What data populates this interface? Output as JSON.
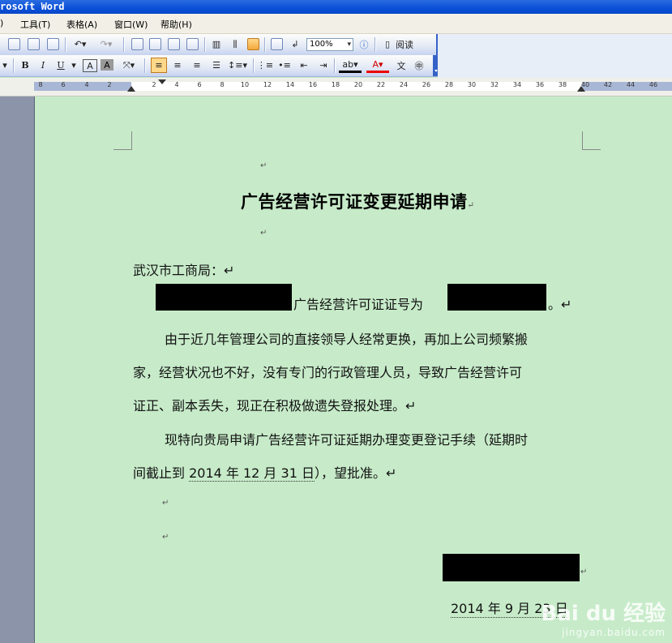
{
  "window": {
    "title": "rosoft Word"
  },
  "menu": [
    {
      "label": ")"
    },
    {
      "label": "工具(T)"
    },
    {
      "label": "表格(A)"
    },
    {
      "label": "窗口(W)"
    },
    {
      "label": "帮助(H)"
    }
  ],
  "toolbar": {
    "zoom": "100%",
    "read_label": "阅读",
    "bold": "B",
    "italic": "I",
    "underline": "U",
    "font_color_glyph": "A",
    "char_shading_glyph": "A"
  },
  "ruler": {
    "left_numbers": [
      "8",
      "6",
      "4",
      "2"
    ],
    "right_numbers": [
      "2",
      "4",
      "6",
      "8",
      "10",
      "12",
      "14",
      "16",
      "18",
      "20",
      "22",
      "24",
      "26",
      "28",
      "30",
      "32",
      "34",
      "36",
      "38",
      "40",
      "42",
      "44",
      "46"
    ]
  },
  "document": {
    "title": "广告经营许可证变更延期申请",
    "title_mark": "↵",
    "salutation": "武汉市工商局：↵",
    "line2_mid": "广告经营许可证证号为",
    "line2_end": "。↵",
    "p1_l1": "由于近几年管理公司的直接领导人经常更换，再加上公司频繁搬",
    "p1_l2": "家，经营状况也不好，没有专门的行政管理人员，导致广告经营许可",
    "p1_l3": "证正、副本丢失，现正在积极做遗失登报处理。↵",
    "p2_l1": "现特向贵局申请广告经营许可证延期办理变更登记手续（延期时",
    "p2_l2_a": "间截止到 ",
    "p2_l2_date": "2014 年 12 月 31 日",
    "p2_l2_b": "），望批准。↵",
    "date_line": "2014 年 9 月 23 日",
    "para_mark": "↵"
  },
  "watermark": {
    "brand": "Bai du 经验",
    "url": "jingyan.baidu.com"
  }
}
